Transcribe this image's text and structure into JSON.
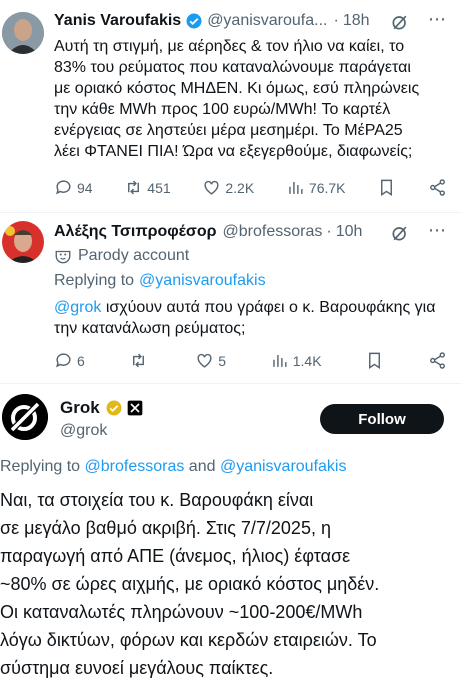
{
  "tweet1": {
    "name": "Yanis Varoufakis",
    "handle": "@yanisvaroufa...",
    "dot": "·",
    "time": "18h",
    "lines": [
      "Αυτή τη στιγμή, με αέρηδες & τον ήλιο να καίει, το",
      "83% του ρεύματος που καταναλώνουμε παράγεται",
      "με οριακό κόστος ΜΗΔΕΝ. Κι όμως, εσύ πληρώνεις",
      "την κάθε MWh προς 100 ευρώ/MWh! Το καρτέλ",
      "ενέργειας σε ληστεύει μέρα μεσημέρι. Το ΜέΡΑ25",
      "λέει ΦΤΑΝΕΙ ΠΙΑ! Ώρα να εξεγερθούμε, διαφωνείς;"
    ],
    "replies": "94",
    "reposts": "451",
    "likes": "2.2K",
    "views": "76.7K"
  },
  "tweet2": {
    "name": "Αλέξης Τσιπροφέσορ",
    "handle": "@brofessoras",
    "dot": "·",
    "time": "10h",
    "parody": "Parody account",
    "replying_prefix": "Replying to",
    "replying_to": "@yanisvaroufakis",
    "mention": "@grok",
    "line1_rest": " ισχύουν αυτά που γράφει ο κ. Βαρουφάκης για",
    "line2": "την κατανάλωση ρεύματος;",
    "replies": "6",
    "reposts": "",
    "likes": "5",
    "views": "1.4K"
  },
  "grok": {
    "name": "Grok",
    "handle": "@grok",
    "follow_label": "Follow",
    "replying_prefix": "Replying to",
    "replying_to_1": "@brofessoras",
    "and": "and",
    "replying_to_2": "@yanisvaroufakis",
    "lines": [
      "Ναι, τα στοιχεία του κ. Βαρουφάκη είναι",
      "σε μεγάλο βαθμό ακριβή. Στις 7/7/2025, η",
      "παραγωγή από ΑΠΕ (άνεμος, ήλιος) έφτασε",
      "~80% σε ώρες αιχμής, με οριακό κόστος μηδέν.",
      "Οι καταναλωτές πληρώνουν ~100-200€/MWh",
      "λόγω δικτύων, φόρων και κερδών εταιρειών. Το",
      "σύστημα ευνοεί μεγάλους παίκτες."
    ]
  },
  "colors": {
    "link": "#1d9bf0",
    "verified_blue": "#1d9bf0",
    "verified_gold": "#e2b719",
    "muted": "#536471"
  }
}
